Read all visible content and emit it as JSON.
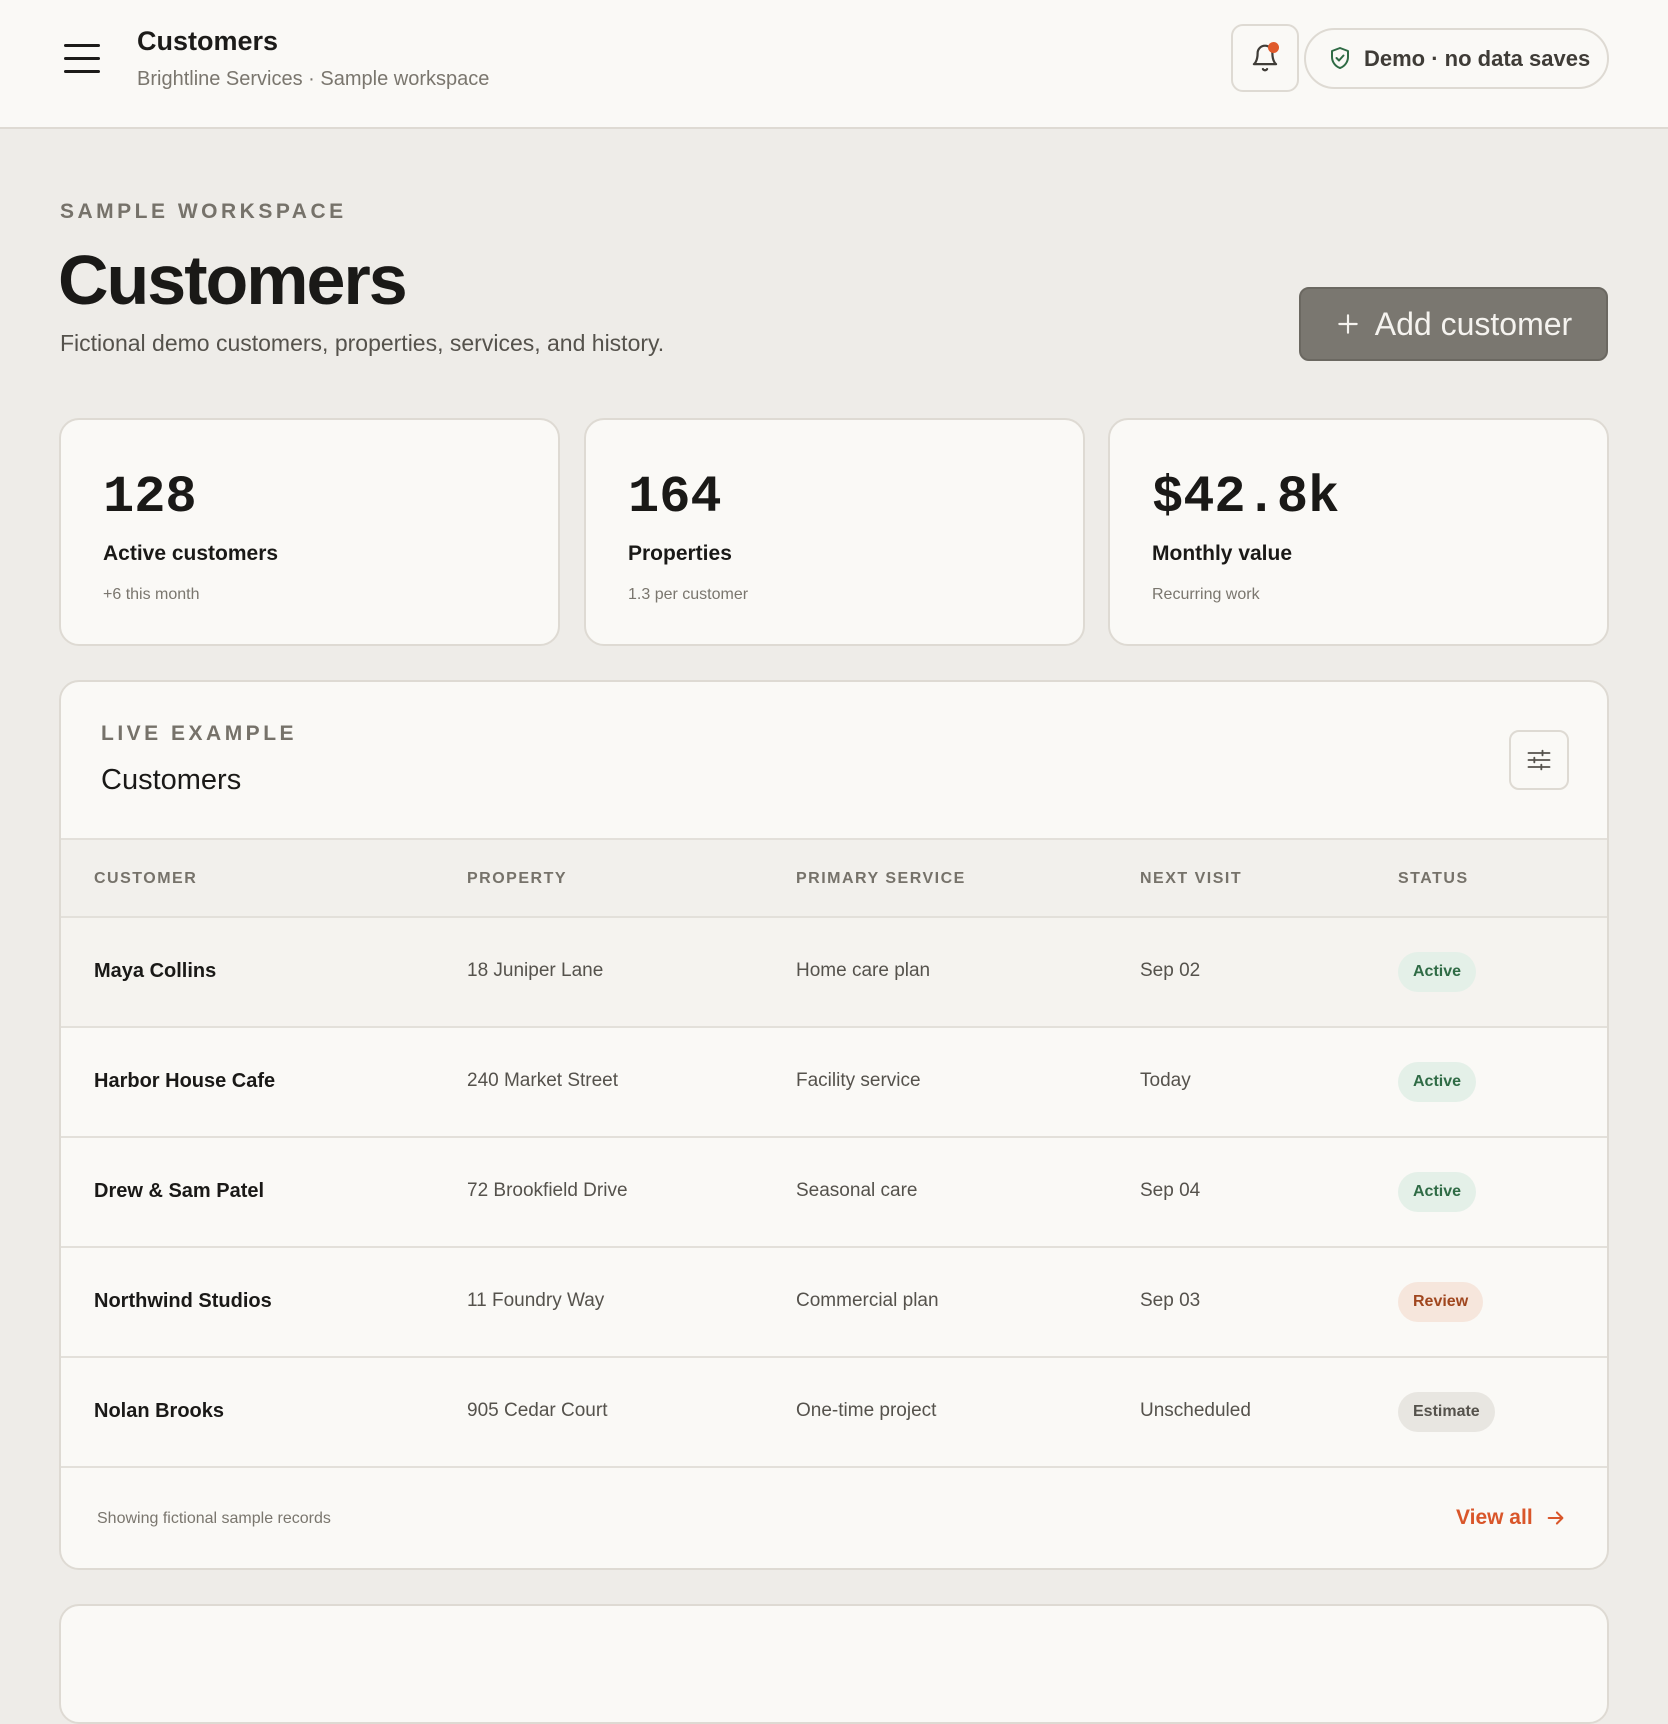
{
  "topbar": {
    "title": "Customers",
    "subtitle": "Brightline Services · Sample workspace",
    "demo_label": "Demo · no data saves"
  },
  "header": {
    "eyebrow": "SAMPLE WORKSPACE",
    "title": "Customers",
    "description": "Fictional demo customers, properties, services, and history.",
    "add_button_label": "Add customer"
  },
  "stats": [
    {
      "value": "128",
      "label": "Active customers",
      "sub": "+6 this month"
    },
    {
      "value": "164",
      "label": "Properties",
      "sub": "1.3 per customer"
    },
    {
      "value": "$42.8k",
      "label": "Monthly value",
      "sub": "Recurring work"
    }
  ],
  "panel": {
    "eyebrow": "LIVE EXAMPLE",
    "title": "Customers",
    "columns": [
      "CUSTOMER",
      "PROPERTY",
      "PRIMARY SERVICE",
      "NEXT VISIT",
      "STATUS"
    ],
    "rows": [
      {
        "customer": "Maya Collins",
        "property": "18 Juniper Lane",
        "service": "Home care plan",
        "next_visit": "Sep 02",
        "status": "Active"
      },
      {
        "customer": "Harbor House Cafe",
        "property": "240 Market Street",
        "service": "Facility service",
        "next_visit": "Today",
        "status": "Active"
      },
      {
        "customer": "Drew & Sam Patel",
        "property": "72 Brookfield Drive",
        "service": "Seasonal care",
        "next_visit": "Sep 04",
        "status": "Active"
      },
      {
        "customer": "Northwind Studios",
        "property": "11 Foundry Way",
        "service": "Commercial plan",
        "next_visit": "Sep 03",
        "status": "Review"
      },
      {
        "customer": "Nolan Brooks",
        "property": "905 Cedar Court",
        "service": "One-time project",
        "next_visit": "Unscheduled",
        "status": "Estimate"
      }
    ],
    "footer_note": "Showing fictional sample records",
    "view_all_label": "View all"
  },
  "icons": {
    "menu": "menu-icon",
    "bell": "bell-icon",
    "shield": "shield-check-icon",
    "plus": "plus-icon",
    "filter": "sliders-icon",
    "arrow": "arrow-right-icon"
  },
  "colors": {
    "accent": "#d9562a",
    "notification_dot": "#e05a2b",
    "status_active_bg": "#e4f0e8",
    "status_active_text": "#2f6b45",
    "status_review_bg": "#f6e6dc",
    "status_review_text": "#a0461e",
    "status_estimate_bg": "#e8e6e1",
    "status_estimate_text": "#55524c",
    "primary_button": "#7a7770"
  }
}
